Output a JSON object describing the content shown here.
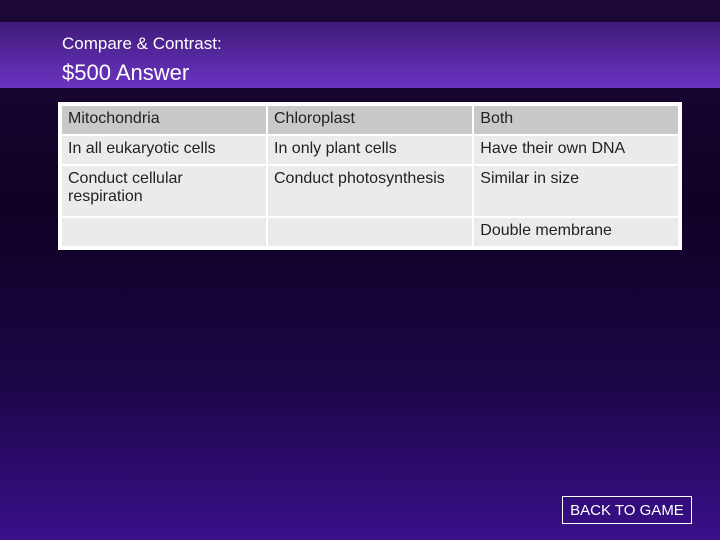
{
  "header": {
    "subtitle": "Compare & Contrast:",
    "title": "$500 Answer"
  },
  "table": {
    "columns": [
      "Mitochondria",
      "Chloroplast",
      "Both"
    ],
    "rows": [
      [
        "In all eukaryotic cells",
        "In only plant cells",
        "Have their own DNA"
      ],
      [
        "Conduct cellular respiration",
        "Conduct photosynthesis",
        "Similar in size"
      ],
      [
        "",
        "",
        "Double membrane"
      ]
    ]
  },
  "nav": {
    "back_label": "BACK TO GAME"
  }
}
